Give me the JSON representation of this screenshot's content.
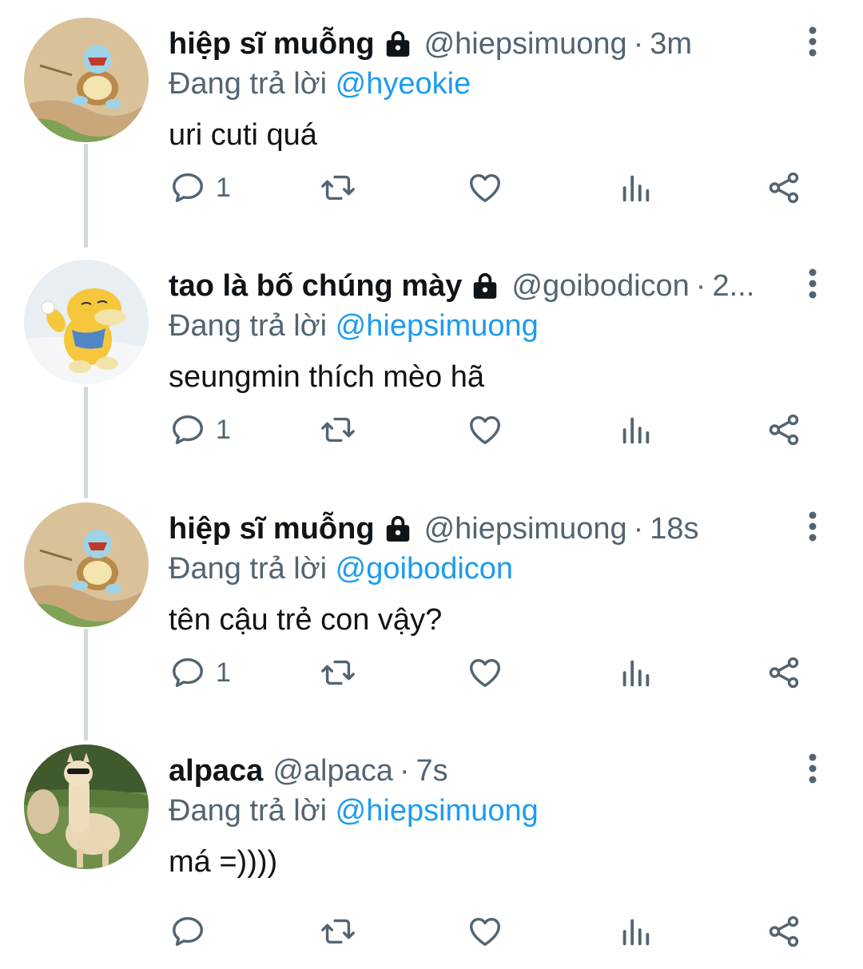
{
  "reply_prefix": "Đang trả lời",
  "colors": {
    "text": "#0f1419",
    "muted": "#536471",
    "link": "#1d9bf0",
    "thread_line": "#cfd9de"
  },
  "tweets": [
    {
      "display_name": "hiệp sĩ muỗng",
      "handle": "@hiepsimuong",
      "time": "3m",
      "reply_to": "@hyeokie",
      "text": "uri cuti quá",
      "reply_count": "1",
      "protected": true,
      "avatar": "squirtle-avatar"
    },
    {
      "display_name": "tao là bố chúng mày",
      "handle": "@goibodicon",
      "time": "2...",
      "reply_to": "@hiepsimuong",
      "text": "seungmin thích mèo hã",
      "reply_count": "1",
      "protected": true,
      "avatar": "psyduck-avatar"
    },
    {
      "display_name": "hiệp sĩ muỗng",
      "handle": "@hiepsimuong",
      "time": "18s",
      "reply_to": "@goibodicon",
      "text": "tên cậu trẻ con vậy?",
      "reply_count": "1",
      "protected": true,
      "avatar": "squirtle-avatar"
    },
    {
      "display_name": "alpaca",
      "handle": "@alpaca",
      "time": "7s",
      "reply_to": "@hiepsimuong",
      "text": "má =))))",
      "reply_count": "",
      "protected": false,
      "avatar": "alpaca-avatar"
    }
  ],
  "icons": {
    "reply": "reply-icon",
    "retweet": "retweet-icon",
    "like": "like-icon",
    "views": "views-icon",
    "share": "share-icon",
    "more": "more-icon",
    "lock": "lock-icon"
  }
}
